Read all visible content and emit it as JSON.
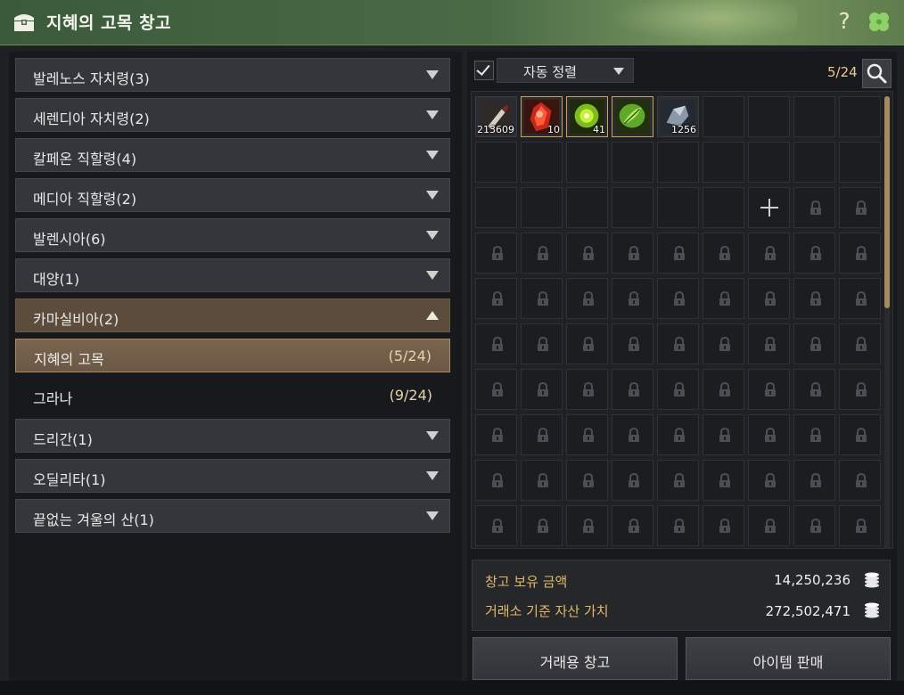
{
  "window": {
    "title": "지혜의 고목 창고",
    "help_label": "?",
    "title_icon": "chest-icon",
    "clover_icon": "clover-icon"
  },
  "categories": [
    {
      "label": "발레노스 자치령(3)",
      "expanded": false
    },
    {
      "label": "세렌디아 자치령(2)",
      "expanded": false
    },
    {
      "label": "칼페온 직할령(4)",
      "expanded": false
    },
    {
      "label": "메디아 직할령(2)",
      "expanded": false
    },
    {
      "label": "발렌시아(6)",
      "expanded": false
    },
    {
      "label": "대양(1)",
      "expanded": false
    },
    {
      "label": "카마실비아(2)",
      "expanded": true,
      "children": [
        {
          "label": "지혜의 고목",
          "count": "(5/24)",
          "selected": true
        },
        {
          "label": "그라나",
          "count": "(9/24)",
          "selected": false
        }
      ]
    },
    {
      "label": "드리간(1)",
      "expanded": false
    },
    {
      "label": "오딜리타(1)",
      "expanded": false
    },
    {
      "label": "끝없는 겨울의 산(1)",
      "expanded": false
    }
  ],
  "storage": {
    "sort_checked": true,
    "sort_label": "자동 정렬",
    "capacity": "5/24",
    "items": [
      {
        "icon": "bait-item-icon",
        "qty": "213609"
      },
      {
        "icon": "red-crystal-icon",
        "qty": "10"
      },
      {
        "icon": "green-stone-icon",
        "qty": "41"
      },
      {
        "icon": "green-leaf-icon",
        "qty": ""
      },
      {
        "icon": "gray-ore-icon",
        "qty": "1256"
      }
    ],
    "open_slots": 24,
    "expand_slot_icon": "plus-icon",
    "lock_icon": "lock-icon",
    "columns": 9,
    "rows": 10,
    "scroll_position": 0
  },
  "money": {
    "silver_label": "창고 보유 금액",
    "silver_value": "14,250,236",
    "asset_label": "거래소 기준 자산 가치",
    "asset_value": "272,502,471",
    "coin_icon": "coin-stack-icon"
  },
  "buttons": {
    "trade_storage": "거래용 창고",
    "sell_item": "아이템 판매"
  },
  "colors": {
    "title_green": "#4b6b47",
    "accent_gold": "#e2b868",
    "selected_row": "#7a654e"
  }
}
